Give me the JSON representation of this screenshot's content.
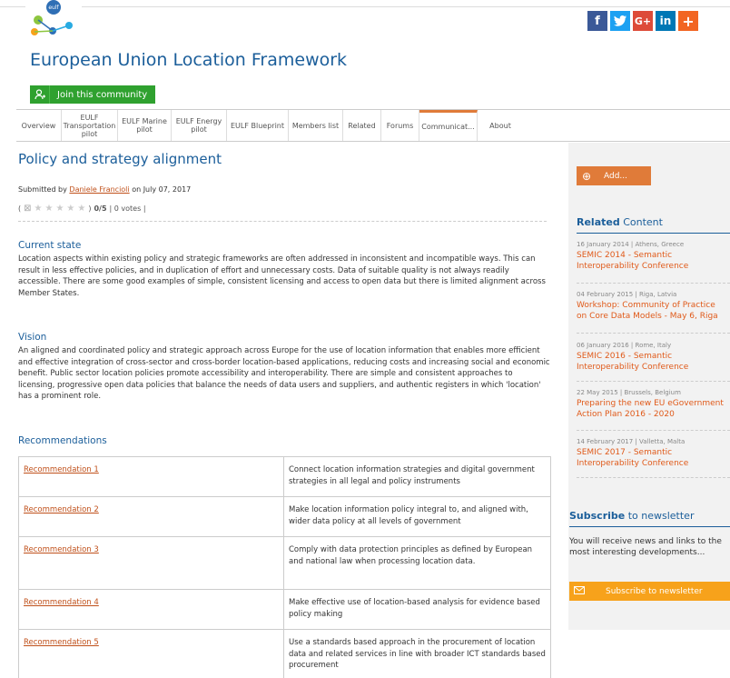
{
  "header": {
    "logo_text": "eulf",
    "site_title": "European Union Location Framework",
    "join_label": "Join this community"
  },
  "social": [
    "f",
    "t",
    "G+",
    "in",
    "+"
  ],
  "tabs": [
    {
      "label": "Overview"
    },
    {
      "label": "EULF Transportation pilot"
    },
    {
      "label": "EULF Marine pilot"
    },
    {
      "label": "EULF Energy pilot"
    },
    {
      "label": "EULF Blueprint"
    },
    {
      "label": "Members list"
    },
    {
      "label": "Related"
    },
    {
      "label": "Forums"
    },
    {
      "label": "Communicat..."
    },
    {
      "label": "About"
    }
  ],
  "article": {
    "title": "Policy and strategy alignment",
    "submitted_prefix": "Submitted by",
    "author": "Daniele Francioli",
    "submitted_suffix": "on July 07, 2017",
    "rating_text": "0/5",
    "votes_text": "| 0 votes |",
    "sections": [
      {
        "heading": "Current state",
        "text": "Location aspects within existing policy and strategic frameworks are often addressed in inconsistent and incompatible ways. This can result in less effective policies, and in duplication of effort and unnecessary costs. Data of suitable quality is not always readily accessible. There are some good examples of simple, consistent licensing and access to open data but there is limited alignment across Member States."
      },
      {
        "heading": "Vision",
        "text": "An aligned and coordinated policy and strategic approach across Europe for the use of location information that enables more efficient and effective integration of cross-sector and cross-border location-based applications, reducing costs and increasing social and economic benefit. Public sector location policies promote accessibility and interoperability. There are simple and consistent approaches to licensing, progressive open data policies that balance the needs of data users and suppliers, and authentic registers in which 'location' has a prominent role."
      },
      {
        "heading": "Recommendations",
        "text": ""
      }
    ],
    "recommendations": [
      {
        "name": "Recommendation 1",
        "text": "Connect location information strategies and digital government strategies in all legal and policy instruments"
      },
      {
        "name": "Recommendation 2",
        "text": "Make location information policy integral to, and aligned with, wider data policy at all levels of government"
      },
      {
        "name": "Recommendation 3",
        "text": "Comply with data protection principles as defined by European and national law when processing location data."
      },
      {
        "name": "Recommendation 4",
        "text": "Make effective use of location-based analysis for evidence based policy making"
      },
      {
        "name": "Recommendation 5",
        "text": "Use a standards based approach in the procurement of location data and related services in line with broader ICT standards based procurement"
      }
    ]
  },
  "sidebar": {
    "add_label": "Add...",
    "related_bold": "Related",
    "related_rest": " Content",
    "related": [
      {
        "meta": "16 January 2014 | Athens, Greece",
        "title1": "SEMIC 2014 - Semantic",
        "title2": "Interoperability Conference"
      },
      {
        "meta": "04 February 2015 | Riga, Latvia",
        "title1": "Workshop: Community of Practice",
        "title2": "on Core Data Models - May 6, Riga"
      },
      {
        "meta": "06 January 2016 | Rome, Italy",
        "title1": "SEMIC 2016 - Semantic",
        "title2": "Interoperability Conference"
      },
      {
        "meta": "22 May 2015 | Brussels, Belgium",
        "title1": "Preparing the new EU eGovernment",
        "title2": "Action Plan 2016 - 2020"
      },
      {
        "meta": "14 February 2017 | Valletta, Malta",
        "title1": "SEMIC 2017 - Semantic",
        "title2": "Interoperability Conference"
      }
    ],
    "subscribe_bold": "Subscribe",
    "subscribe_rest": " to newsletter",
    "subscribe_text": "You will receive news and links to the most interesting developments...",
    "subscribe_button": "Subscribe to newsletter"
  },
  "colors": {
    "brand_blue": "#1b5e9a",
    "accent_orange": "#e07b39",
    "join_green": "#2fa12f",
    "subscribe_yellow": "#f7a21b"
  }
}
